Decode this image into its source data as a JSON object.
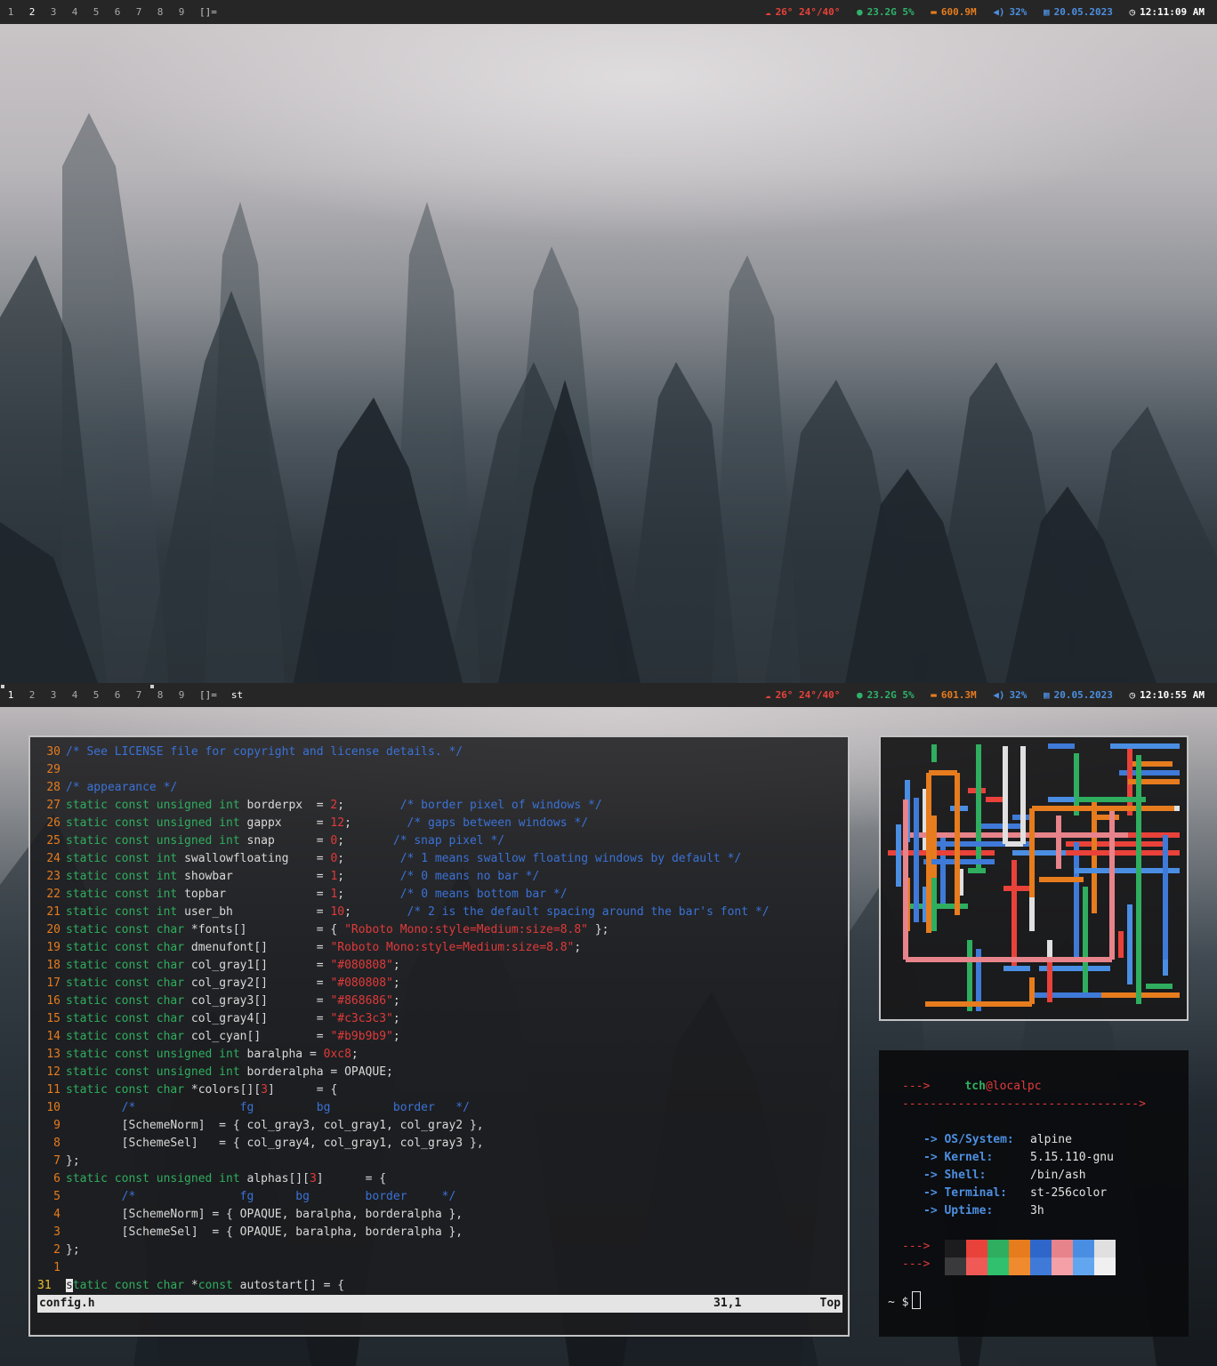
{
  "top_bar": {
    "tags": [
      "1",
      "2",
      "3",
      "4",
      "5",
      "6",
      "7",
      "8",
      "9"
    ],
    "layout": "[]=",
    "weather_icon": "cloud-icon",
    "weather": "26° 24°/40°",
    "disk_icon": "disk-icon",
    "disk": "23.2G 5%",
    "memory_icon": "memory-icon",
    "memory": "600.9M",
    "volume_icon": "speaker-icon",
    "volume": "32%",
    "date_icon": "calendar-icon",
    "date": "20.05.2023",
    "clock_icon": "clock-icon",
    "time": "12:11:09 AM"
  },
  "bottom_bar": {
    "tags": [
      "1",
      "2",
      "3",
      "4",
      "5",
      "6",
      "7",
      "8",
      "9"
    ],
    "layout": "[]=",
    "window_title": "st",
    "weather": "26° 24°/40°",
    "disk": "23.2G 5%",
    "memory": "601.3M",
    "volume": "32%",
    "date": "20.05.2023",
    "time": "12:10:55 AM"
  },
  "colors": {
    "bar_bg": "#262626",
    "red": "#e8423a",
    "green": "#2fb36b",
    "orange": "#e67c1e",
    "blue": "#4d8fe0"
  },
  "editor": {
    "lines": [
      {
        "n": "30",
        "t": [
          [
            "cm",
            "/* See LICENSE file for copyright and license details. */"
          ]
        ]
      },
      {
        "n": "29",
        "t": []
      },
      {
        "n": "28",
        "t": [
          [
            "cm",
            "/* appearance */"
          ]
        ]
      },
      {
        "n": "27",
        "t": [
          [
            "k",
            "static const unsigned int "
          ],
          [
            "",
            "borderpx  = "
          ],
          [
            "n",
            "2"
          ],
          [
            "",
            ";        "
          ],
          [
            "cm",
            "/* border pixel of windows */"
          ]
        ]
      },
      {
        "n": "26",
        "t": [
          [
            "k",
            "static const unsigned int "
          ],
          [
            "",
            "gappx     = "
          ],
          [
            "n",
            "12"
          ],
          [
            "",
            ";        "
          ],
          [
            "cm",
            "/* gaps between windows */"
          ]
        ]
      },
      {
        "n": "25",
        "t": [
          [
            "k",
            "static const unsigned int "
          ],
          [
            "",
            "snap      = "
          ],
          [
            "n",
            "0"
          ],
          [
            "",
            ";       "
          ],
          [
            "cm",
            "/* snap pixel */"
          ]
        ]
      },
      {
        "n": "24",
        "t": [
          [
            "k",
            "static const int "
          ],
          [
            "",
            "swallowfloating    = "
          ],
          [
            "n",
            "0"
          ],
          [
            "",
            ";        "
          ],
          [
            "cm",
            "/* 1 means swallow floating windows by default */"
          ]
        ]
      },
      {
        "n": "23",
        "t": [
          [
            "k",
            "static const int "
          ],
          [
            "",
            "showbar            = "
          ],
          [
            "n",
            "1"
          ],
          [
            "",
            ";        "
          ],
          [
            "cm",
            "/* 0 means no bar */"
          ]
        ]
      },
      {
        "n": "22",
        "t": [
          [
            "k",
            "static const int "
          ],
          [
            "",
            "topbar             = "
          ],
          [
            "n",
            "1"
          ],
          [
            "",
            ";        "
          ],
          [
            "cm",
            "/* 0 means bottom bar */"
          ]
        ]
      },
      {
        "n": "21",
        "t": [
          [
            "k",
            "static const int "
          ],
          [
            "",
            "user_bh            = "
          ],
          [
            "n",
            "10"
          ],
          [
            "",
            ";        "
          ],
          [
            "cm",
            "/* 2 is the default spacing around the bar's font */"
          ]
        ]
      },
      {
        "n": "20",
        "t": [
          [
            "k",
            "static const char "
          ],
          [
            "",
            "*fonts[]          = { "
          ],
          [
            "s",
            "\"Roboto Mono:style=Medium:size=8.8\""
          ],
          [
            "",
            " };"
          ]
        ]
      },
      {
        "n": "19",
        "t": [
          [
            "k",
            "static const char "
          ],
          [
            "",
            "dmenufont[]       = "
          ],
          [
            "s",
            "\"Roboto Mono:style=Medium:size=8.8\""
          ],
          [
            "",
            ";"
          ]
        ]
      },
      {
        "n": "18",
        "t": [
          [
            "k",
            "static const char "
          ],
          [
            "",
            "col_gray1[]       = "
          ],
          [
            "s",
            "\"#080808\""
          ],
          [
            "",
            ";"
          ]
        ]
      },
      {
        "n": "17",
        "t": [
          [
            "k",
            "static const char "
          ],
          [
            "",
            "col_gray2[]       = "
          ],
          [
            "s",
            "\"#080808\""
          ],
          [
            "",
            ";"
          ]
        ]
      },
      {
        "n": "16",
        "t": [
          [
            "k",
            "static const char "
          ],
          [
            "",
            "col_gray3[]       = "
          ],
          [
            "s",
            "\"#868686\""
          ],
          [
            "",
            ";"
          ]
        ]
      },
      {
        "n": "15",
        "t": [
          [
            "k",
            "static const char "
          ],
          [
            "",
            "col_gray4[]       = "
          ],
          [
            "s",
            "\"#c3c3c3\""
          ],
          [
            "",
            ";"
          ]
        ]
      },
      {
        "n": "14",
        "t": [
          [
            "k",
            "static const char "
          ],
          [
            "",
            "col_cyan[]        = "
          ],
          [
            "s",
            "\"#b9b9b9\""
          ],
          [
            "",
            ";"
          ]
        ]
      },
      {
        "n": "13",
        "t": [
          [
            "k",
            "static const unsigned int "
          ],
          [
            "",
            "baralpha = "
          ],
          [
            "n",
            "0xc8"
          ],
          [
            "",
            ";"
          ]
        ]
      },
      {
        "n": "12",
        "t": [
          [
            "k",
            "static const unsigned int "
          ],
          [
            "",
            "borderalpha = OPAQUE;"
          ]
        ]
      },
      {
        "n": "11",
        "t": [
          [
            "k",
            "static const char "
          ],
          [
            "",
            "*colors[]["
          ],
          [
            "n",
            "3"
          ],
          [
            "",
            "]      = {"
          ]
        ]
      },
      {
        "n": "10",
        "t": [
          [
            "",
            "        "
          ],
          [
            "cm",
            "/*               fg         bg         border   */"
          ]
        ]
      },
      {
        "n": "9",
        "t": [
          [
            "",
            "        [SchemeNorm]  = { col_gray3, col_gray1, col_gray2 },"
          ]
        ]
      },
      {
        "n": "8",
        "t": [
          [
            "",
            "        [SchemeSel]   = { col_gray4, col_gray1, col_gray3 },"
          ]
        ]
      },
      {
        "n": "7",
        "t": [
          [
            "",
            "};"
          ]
        ]
      },
      {
        "n": "6",
        "t": [
          [
            "k",
            "static const unsigned int "
          ],
          [
            "",
            "alphas[]["
          ],
          [
            "n",
            "3"
          ],
          [
            "",
            "]      = {"
          ]
        ]
      },
      {
        "n": "5",
        "t": [
          [
            "",
            "        "
          ],
          [
            "cm",
            "/*               fg      bg        border     */"
          ]
        ]
      },
      {
        "n": "4",
        "t": [
          [
            "",
            "        [SchemeNorm] = { OPAQUE, baralpha, borderalpha },"
          ]
        ]
      },
      {
        "n": "3",
        "t": [
          [
            "",
            "        [SchemeSel]  = { OPAQUE, baralpha, borderalpha },"
          ]
        ]
      },
      {
        "n": "2",
        "t": [
          [
            "",
            "};"
          ]
        ]
      },
      {
        "n": "1",
        "t": []
      }
    ],
    "current_line": {
      "n": "31",
      "cursor_char": "s",
      "rest_kw": "tatic const char ",
      "rest": "*",
      "kw2": "const",
      "tail": " autostart[] = {"
    },
    "status": {
      "file": "config.h",
      "position": "31,1",
      "scroll": "Top"
    }
  },
  "fetch": {
    "arrow_short": "--->",
    "user": "tch",
    "at": "@",
    "host": "localpc",
    "separator": "---------------------------------->",
    "item_arrow": "->",
    "items": [
      {
        "label": "OS/System:",
        "value": "alpine"
      },
      {
        "label": "Kernel:",
        "value": "5.15.110-gnu"
      },
      {
        "label": "Shell:",
        "value": "/bin/ash"
      },
      {
        "label": "Terminal:",
        "value": "st-256color"
      },
      {
        "label": "Uptime:",
        "value": "3h"
      }
    ],
    "palette_top": [
      "#1c1c1e",
      "#e8423a",
      "#2fae5f",
      "#e67c1e",
      "#2f66c9",
      "#e7838a",
      "#4a8ee3",
      "#e0e0e0"
    ],
    "palette_bottom": [
      "#3a3a3c",
      "#ef5a57",
      "#31c06d",
      "#f08a2e",
      "#3f7ad8",
      "#f4a0a6",
      "#63a6f0",
      "#f0f0f0"
    ],
    "prompt": "~ $"
  }
}
